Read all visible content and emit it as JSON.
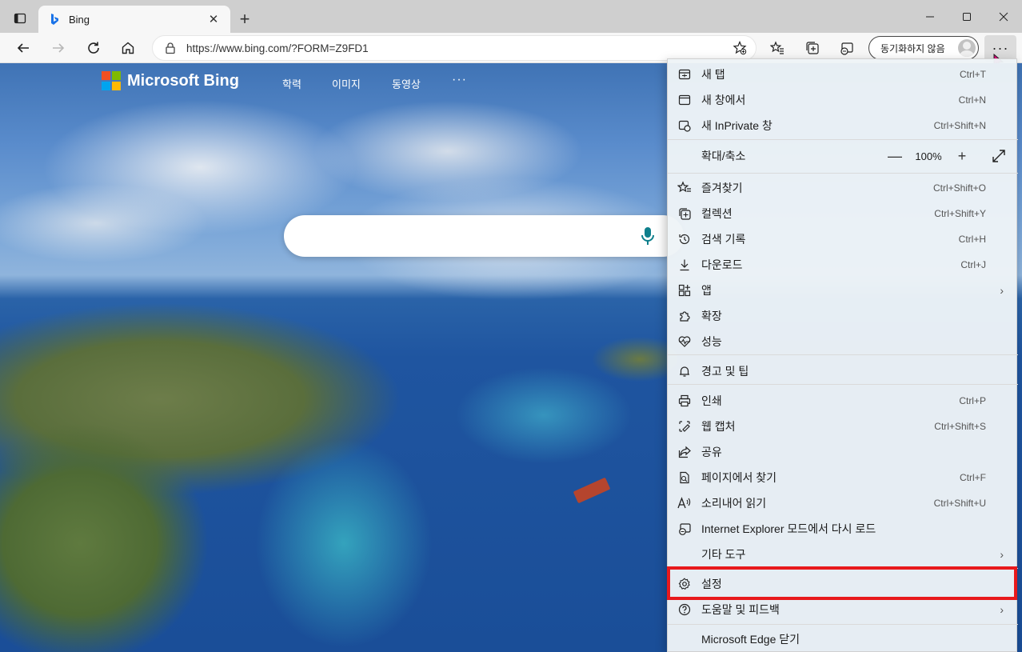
{
  "tab": {
    "title": "Bing"
  },
  "address_bar": {
    "url": "https://www.bing.com/?FORM=Z9FD1"
  },
  "sync_button": {
    "label": "동기화하지 않음"
  },
  "bing": {
    "logo_text": "Microsoft Bing",
    "nav": [
      "학력",
      "이미지",
      "동영상",
      "···"
    ],
    "brand_colors": [
      "#f25022",
      "#7fba00",
      "#00a4ef",
      "#ffb900"
    ]
  },
  "menu": {
    "items": [
      {
        "label": "새 탭",
        "shortcut": "Ctrl+T",
        "icon": "new-tab-icon"
      },
      {
        "label": "새 창에서",
        "shortcut": "Ctrl+N",
        "icon": "new-window-icon"
      },
      {
        "label": "새 InPrivate 창",
        "shortcut": "Ctrl+Shift+N",
        "icon": "inprivate-icon"
      },
      {
        "label": "확대/축소",
        "icon": "zoom-icon"
      },
      {
        "label": "즐겨찾기",
        "shortcut": "Ctrl+Shift+O",
        "icon": "favorites-icon"
      },
      {
        "label": "컬렉션",
        "shortcut": "Ctrl+Shift+Y",
        "icon": "collections-icon"
      },
      {
        "label": "검색 기록",
        "shortcut": "Ctrl+H",
        "icon": "history-icon"
      },
      {
        "label": "다운로드",
        "shortcut": "Ctrl+J",
        "icon": "download-icon"
      },
      {
        "label": "앱",
        "icon": "apps-icon"
      },
      {
        "label": "확장",
        "icon": "extensions-icon"
      },
      {
        "label": "성능",
        "icon": "performance-icon"
      },
      {
        "label": "경고 및 팁",
        "icon": "bell-icon"
      },
      {
        "label": "인쇄",
        "shortcut": "Ctrl+P",
        "icon": "print-icon"
      },
      {
        "label": "웹 캡처",
        "shortcut": "Ctrl+Shift+S",
        "icon": "web-capture-icon"
      },
      {
        "label": "공유",
        "icon": "share-icon"
      },
      {
        "label": "페이지에서 찾기",
        "shortcut": "Ctrl+F",
        "icon": "find-icon"
      },
      {
        "label": "소리내어 읽기",
        "shortcut": "Ctrl+Shift+U",
        "icon": "read-aloud-icon"
      },
      {
        "label": "Internet Explorer 모드에서 다시 로드",
        "icon": "ie-mode-icon"
      },
      {
        "label": "기타 도구"
      },
      {
        "label": "설정",
        "icon": "gear-icon"
      },
      {
        "label": "도움말 및 피드백",
        "icon": "help-icon"
      },
      {
        "label": "Microsoft Edge 닫기"
      }
    ],
    "zoom": {
      "minus": "—",
      "value": "100%",
      "plus": "+"
    },
    "highlighted_item": "설정",
    "highlight_color": "#e8191c"
  }
}
